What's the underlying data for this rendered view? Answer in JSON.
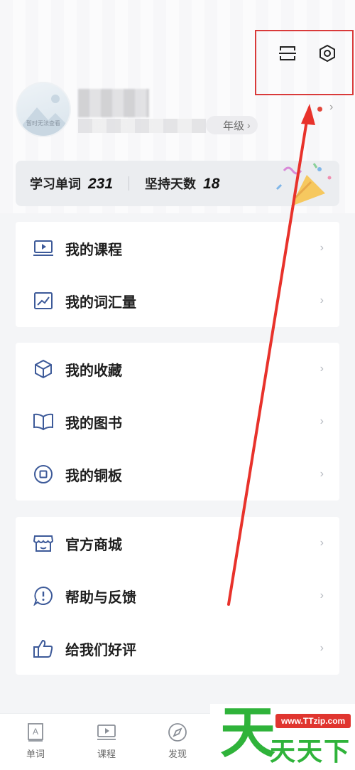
{
  "header": {
    "scan_icon": "scan-icon",
    "settings_icon": "settings-icon"
  },
  "profile": {
    "avatar_caption": "暂时无法查看",
    "grade_suffix": "年级",
    "chevron": "›"
  },
  "stats": {
    "words_label": "学习单词",
    "words_value": "231",
    "days_label": "坚持天数",
    "days_value": "18"
  },
  "menu_groups": [
    {
      "items": [
        {
          "icon": "course-icon",
          "label": "我的课程"
        },
        {
          "icon": "chart-icon",
          "label": "我的词汇量"
        }
      ]
    },
    {
      "items": [
        {
          "icon": "cube-icon",
          "label": "我的收藏"
        },
        {
          "icon": "book-icon",
          "label": "我的图书"
        },
        {
          "icon": "coin-icon",
          "label": "我的铜板"
        }
      ]
    },
    {
      "items": [
        {
          "icon": "store-icon",
          "label": "官方商城"
        },
        {
          "icon": "help-icon",
          "label": "帮助与反馈"
        },
        {
          "icon": "thumbs-up-icon",
          "label": "给我们好评"
        }
      ]
    }
  ],
  "tabbar": {
    "tabs": [
      {
        "icon": "word-icon",
        "label": "单词"
      },
      {
        "icon": "video-icon",
        "label": "课程"
      },
      {
        "icon": "compass-icon",
        "label": "发现"
      }
    ]
  },
  "watermark": {
    "big_char": "天",
    "url": "www.TTzip.com",
    "text": "天天下载"
  },
  "colors": {
    "accent_icon": "#3d5a99",
    "highlight_red": "#d93a3a",
    "brand_green": "#2fb33a"
  }
}
